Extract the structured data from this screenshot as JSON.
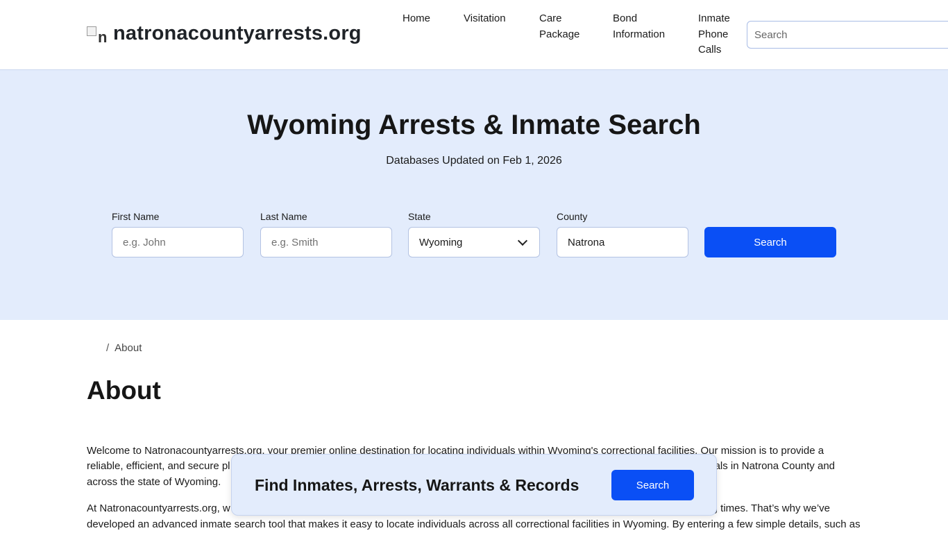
{
  "header": {
    "logo_alt": "n",
    "site_name": "natronacountyarrests.org",
    "nav": {
      "home": "Home",
      "visitation": "Visitation",
      "care_package_1": "Care",
      "care_package_2": "Package",
      "bond_1": "Bond",
      "bond_2": "Information",
      "phone_1": "Inmate",
      "phone_2": "Phone",
      "phone_3": "Calls"
    },
    "search_placeholder": "Search"
  },
  "hero": {
    "title": "Wyoming Arrests & Inmate Search",
    "subtitle": "Databases Updated on Feb 1, 2026",
    "first_name_label": "First Name",
    "first_name_placeholder": "e.g. John",
    "last_name_label": "Last Name",
    "last_name_placeholder": "e.g. Smith",
    "state_label": "State",
    "state_value": "Wyoming",
    "county_label": "County",
    "county_value": "Natrona",
    "search_button": "Search"
  },
  "breadcrumb": {
    "separator": "/",
    "current": "About"
  },
  "content": {
    "title": "About",
    "para1_line1": "Welcome to Natronacountyarrests.org, your premier online destination for locating individuals within Wyoming's correctional facilities. Our mission is to provide a",
    "para1_line2": "reliable, efficient, and secure pl",
    "para1_line2_right": "als in Natrona County and",
    "para1_line3": "across the state of Wyoming.",
    "para2_line1": "At Natronacountyarrests.org, w",
    "para2_line1_right": "g times. That’s why we’ve",
    "para2_line2": "developed an advanced inmate search tool that makes it easy to locate individuals across all correctional facilities in Wyoming. By entering a few simple details, such as"
  },
  "float_bar": {
    "text": "Find Inmates, Arrests, Warrants & Records",
    "button": "Search"
  },
  "colors": {
    "accent": "#0a4ff5",
    "hero_bg": "#e3ecfc"
  }
}
